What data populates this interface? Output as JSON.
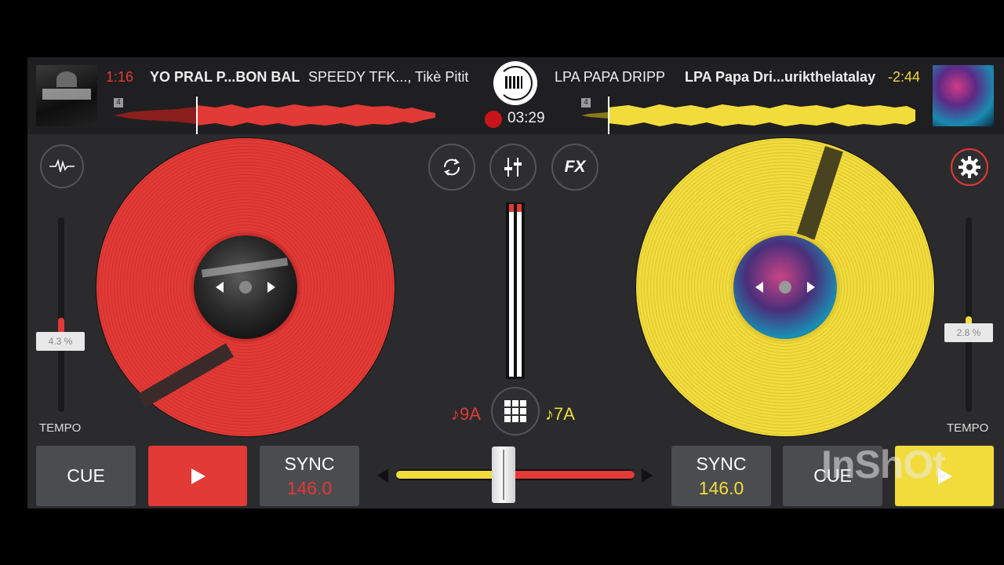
{
  "deck_a": {
    "elapsed": "1:16",
    "title": "YO PRAL P...BON BAL",
    "artist": "SPEEDY TFK..., Tikè Pitit",
    "beat_counter": "4",
    "tempo_label": "TEMPO",
    "pitch": "4.3 %",
    "key": "♪9A",
    "cue_label": "CUE",
    "sync_label": "SYNC",
    "bpm": "146.0",
    "color": "#e23a36"
  },
  "deck_b": {
    "artist": "LPA PAPA DRIPP",
    "title": "LPA Papa Dri...urikthelatalay",
    "remaining": "-2:44",
    "beat_counter": "4",
    "tempo_label": "TEMPO",
    "pitch": "2.8 %",
    "key": "♪7A",
    "cue_label": "CUE",
    "sync_label": "SYNC",
    "bpm": "146.0",
    "color": "#f2dc3c"
  },
  "recording": {
    "time": "03:29"
  },
  "fx_label": "FX",
  "icons": {
    "waveform": "waveform-icon",
    "loop": "loop-icon",
    "mixer": "mixer-icon",
    "settings": "gear-icon",
    "pads": "grid-icon",
    "play": "play-icon"
  },
  "watermark": "InShOt"
}
